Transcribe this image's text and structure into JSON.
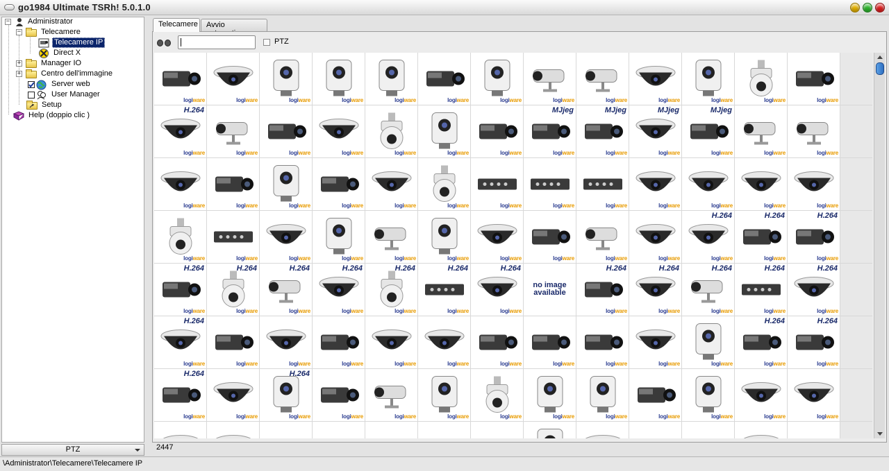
{
  "window": {
    "title": "go1984 Ultimate TSRh! 5.0.1.0",
    "buttons": [
      {
        "name": "minimize-button",
        "color": "#e8b400"
      },
      {
        "name": "maximize-button",
        "color": "#2eb82e"
      },
      {
        "name": "close-button",
        "color": "#e02020"
      }
    ]
  },
  "tree": {
    "items": [
      {
        "label": "Administrator",
        "icon": "user-icon",
        "expanded": true
      },
      {
        "label": "Telecamere",
        "icon": "folder-icon",
        "expanded": true
      },
      {
        "label": "Telecamere IP",
        "icon": "ip-camera-icon",
        "selected": true
      },
      {
        "label": "Direct X",
        "icon": "directx-icon"
      },
      {
        "label": "Manager IO",
        "icon": "folder-icon",
        "expanded": false
      },
      {
        "label": "Centro dell'immagine",
        "icon": "folder-icon",
        "expanded": false
      },
      {
        "label": "Server web",
        "icon": "globe-icon",
        "checked": true
      },
      {
        "label": "User Manager",
        "icon": "users-icon",
        "checked": false
      },
      {
        "label": "Setup",
        "icon": "setup-folder-icon"
      },
      {
        "label": "Help (doppio clic )",
        "icon": "help-book-icon"
      }
    ]
  },
  "ptz_combo": {
    "value": "PTZ"
  },
  "tabs": [
    {
      "label": "Telecamere",
      "active": true
    },
    {
      "label": "Avvio automatico",
      "active": false
    }
  ],
  "toolbar": {
    "search_value": "",
    "ptz_checkbox_label": "PTZ",
    "ptz_checked": false
  },
  "grid": {
    "logo_text_a": "logi",
    "logo_text_b": "ware",
    "rows": [
      [
        "box",
        "dome-ptz",
        "cube",
        "cube",
        "cube",
        "box",
        "cube",
        "bullet",
        "bullet",
        "dome",
        "cube",
        "ptz",
        "box",
        ""
      ],
      [
        "dome-h264",
        "bullet",
        "box",
        "dome",
        "ptz",
        "cube",
        "box",
        "box-mjpeg",
        "box-mjpeg",
        "dome-mjpeg",
        "box-mjpeg",
        "bullet",
        "bullet",
        ""
      ],
      [
        "dome",
        "box",
        "cube",
        "box",
        "dome",
        "ptz",
        "encoder",
        "encoder",
        "encoder",
        "dome",
        "dome",
        "dome",
        "dome",
        ""
      ],
      [
        "ptz",
        "encoder",
        "dome",
        "cube",
        "bullet",
        "cube",
        "dome",
        "box",
        "bullet",
        "dome",
        "dome-h264",
        "box-h264",
        "box-h264",
        ""
      ],
      [
        "box-h264",
        "ptz-h264",
        "bullet-h264",
        "dome-h264",
        "ptz-h264",
        "encoder-h264",
        "dome-h264",
        "noimage",
        "box-h264",
        "dome-h264",
        "bullet-h264",
        "encoder-h264",
        "dome-h264",
        ""
      ],
      [
        "dome-h264",
        "box",
        "dome",
        "box",
        "dome",
        "dome",
        "box",
        "box",
        "box",
        "dome",
        "cube",
        "box-h264",
        "box-h264",
        ""
      ],
      [
        "box-h264",
        "dome",
        "cube-h264",
        "box",
        "bullet",
        "cube",
        "ptz",
        "cube",
        "cube",
        "box",
        "cube",
        "dome",
        "dome",
        ""
      ],
      [
        "dome",
        "dome",
        "bullet",
        "box",
        "box",
        "box",
        "box",
        "cube",
        "dome",
        "box",
        "bullet",
        "dome",
        "bullet",
        ""
      ]
    ],
    "tag_h264": "H.264",
    "tag_mjpeg": "MJjeg",
    "no_image_line1": "no image",
    "no_image_line2": "available",
    "count": "2447"
  },
  "status": {
    "path": "\\Administrator\\Telecamere\\Telecamere IP"
  }
}
